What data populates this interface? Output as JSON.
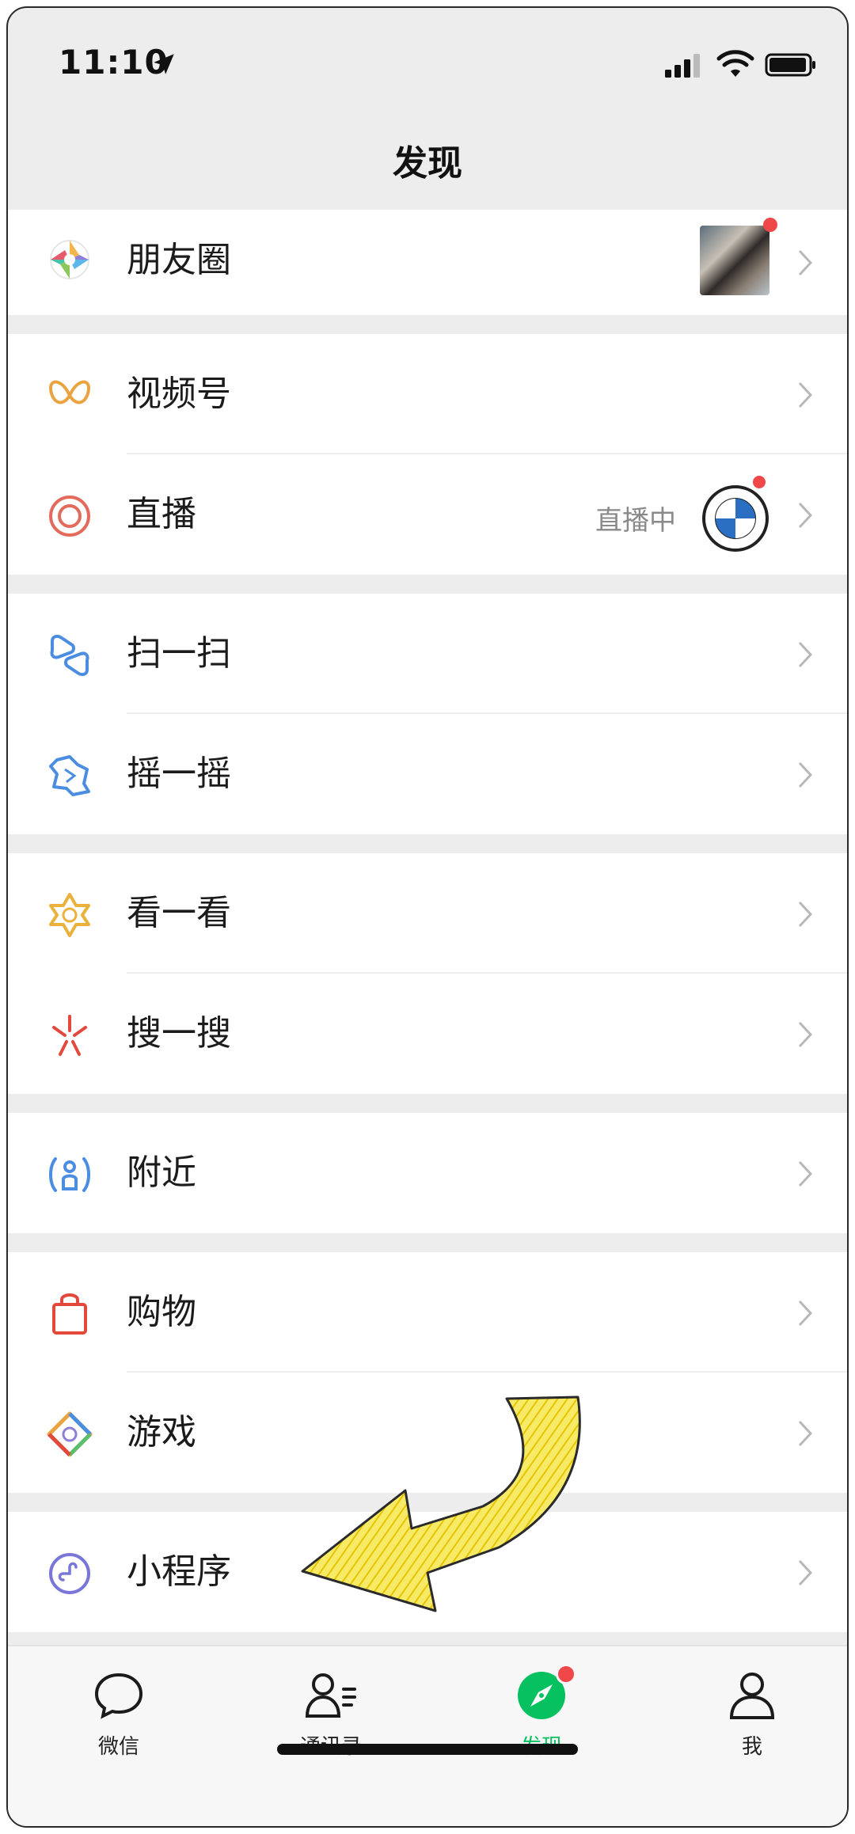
{
  "status_bar": {
    "time": "11:10"
  },
  "nav": {
    "title": "发现"
  },
  "groups": [
    [
      {
        "label": "朋友圈"
      }
    ],
    [
      {
        "label": "视频号"
      },
      {
        "label": "直播",
        "status": "直播中"
      }
    ],
    [
      {
        "label": "扫一扫"
      },
      {
        "label": "摇一摇"
      }
    ],
    [
      {
        "label": "看一看"
      },
      {
        "label": "搜一搜"
      }
    ],
    [
      {
        "label": "附近"
      }
    ],
    [
      {
        "label": "购物"
      },
      {
        "label": "游戏"
      }
    ],
    [
      {
        "label": "小程序"
      }
    ]
  ],
  "tabbar": {
    "tabs": [
      {
        "label": "微信"
      },
      {
        "label": "通讯录"
      },
      {
        "label": "发现"
      },
      {
        "label": "我"
      }
    ],
    "active_index": 2
  },
  "colors": {
    "accent": "#07c160",
    "badge": "#f04848",
    "annotation_arrow": "#f3dc1f"
  }
}
